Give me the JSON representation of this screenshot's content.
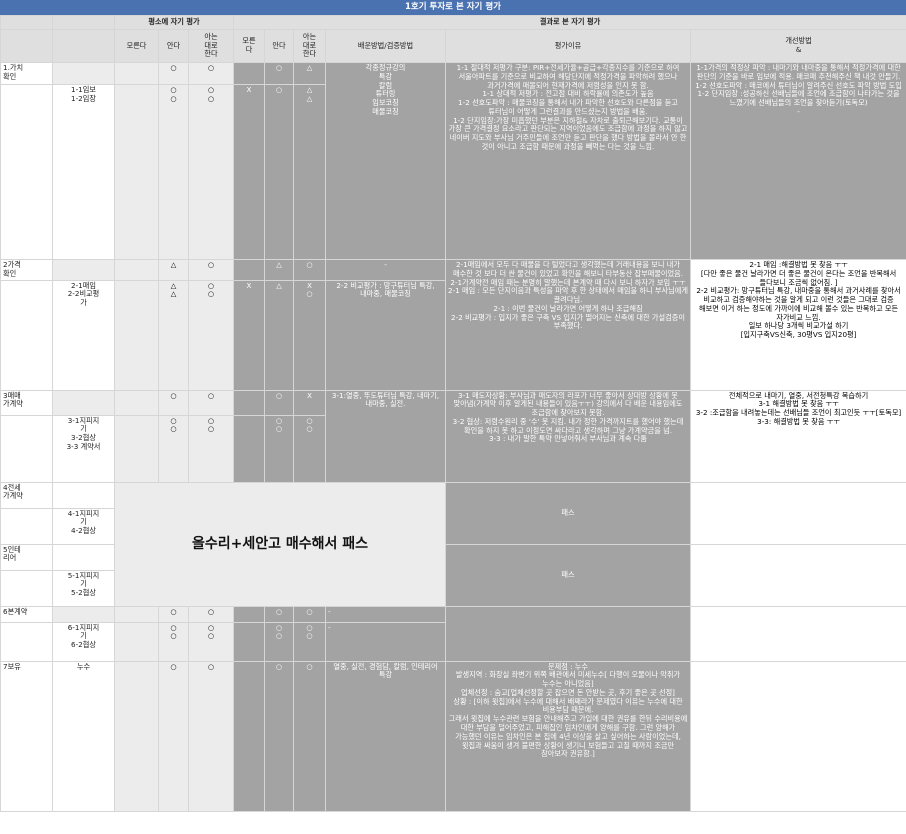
{
  "title": "1호기 투자로 본 자기 평가",
  "header": {
    "usual_group": "평소에 자기 평가",
    "result_group": "결과로 본 자기 평가",
    "col_dont_know": "모른다",
    "col_know": "안다",
    "col_teach": "아는\n대로\n한다",
    "col_dont_know2": "모른\n다",
    "col_know2": "안다",
    "col_teach2": "아는\n대로\n한다",
    "col_learn": "배운방법/검증방법",
    "col_reason": "평가이유",
    "col_improve": "개선방법\n&"
  },
  "rows": {
    "r1": {
      "cat": "1.가치\n확인",
      "know": "○",
      "teach": "○",
      "know2": "○",
      "teach2": "△",
      "learn": "각종정규강의\n특강\n칼럼\n튜터링\n임보코칭\n매물코칭",
      "reason": "1-1 절대적 저평가 구분: PIR+전세가율+공급+각종지수를 기준으로 하여 서울아파트를 기준으로 비교하여 해당단지에 적정가격을 파악하려 했으나 과거가격에 매몰되어 현재가격에 저렴성을 인지 못 함.\n1-1 상대적 저평가 : 전고점 대비 하락률에 의존도가 높음\n1-2 선호도파악 : 매물코칭을 통해서 내가 파악한 선호도와 다른점을 듣고 튜터님이 어떻게 그런결과를 만드셨는지 방법을 배움.\n1-2 단지임장:가장 미흡했던 부분은 지하철& 자차로 출퇴근해보기다. 교통이 가장 큰 가격결정 요소라고 판단되는 지역이었음에도 조급함에 과정을 하지 않고 네이버 지도와 부사님 거주민들에 조언만 듣고 판단을 했다 방법을 몰라서 안 한 것이 아니고 조급함 때문에 과정을 빼먹는 다는 것을 느낌.",
      "improve": "1-1가격의 적정상 파악 : 내마기와 내마중을 통해서 적정가격에 대한 판단의 기준을 바로 임보에 적용. 매코패 추천해주신 책 내것 만들기.\n1-2 선호도파악 : 매코에서 튜터님이 알려주신 선호도 파악 방법 도입\n1-2 단지임장 :성공하신 선배님들에 조언에 조급함이 나타가는 것을 느꼈기에 선배님들의 조언을 찾아듣기(토독모)",
      "improve_dash": "-",
      "sub": "1-1임보\n1-2임장",
      "sub_know": "○\n○",
      "sub_teach": "○\n○",
      "sub_dk2": "X",
      "sub_know2": "○",
      "sub_teach2": "△\n△"
    },
    "r2": {
      "cat": "2가격\n확인",
      "know": "△",
      "teach": "○",
      "know2": "△",
      "teach2": "○",
      "learn": "-",
      "reason": "2-1매임에서 모두 다 매물을 다 털었다고 생각했는데 거래내용을 보니 내가 매수한 것 보다 더 싼 물건이 있었고 확인을 해보니 타부동산 잡부매물이었음.\n2-1가계약전 매임 때는 분명히 말했는데 본계약 때 다시 보니 하자가 보임 ㅜㅜ\n2-1 매임 : 모든 단지이음과 특성을 파악 후 한 상태에서 매임을 하니 부사님에게 끌려다님.\n2-1 : 이번 물건이 날라가면 어떻게 하나 조급해짐\n2-2 비교평가 : 입지가 좋은 구축 VS 입지가 떨어지는 신축에 대한 가설검증이 부족했다.",
      "improve": "2-1 매임 :해결방법 못 찾음 ㅜㅜ\n[다만 좋은 물건 날라가면 더 좋은 물건이 온다는 조언을 반복해서 들다보니 조금씩 없어짐. ]\n2-2 비교평가: 망구튜터님 특강, 내마중을 통해서 과거사례를 찾아서 비교하고 검증해야하는 것을 알게 되고 이런 것들은 그대로 검증 해보면 이거 하는 정도에 가까이에 비교해 볼수 있는 반복하고 모든 자가비교 느낌.\n일보 하나당 3개씩 비교가설 하기\n[입지구축VS신축, 30평VS 입지20평]",
      "sub": "2-1매임\n2-2비교평\n가",
      "sub_know": "△\n△",
      "sub_teach": "○\n○",
      "sub_dk2": "X",
      "sub_know2": "△",
      "sub_teach2": "X\n○",
      "sub_learn": "2-2 비교평가 : 망구튜터님 특강, 내마중, 매물코칭"
    },
    "r3": {
      "cat": "3매매\n가계약",
      "know": "○",
      "teach": "○",
      "know2": "○",
      "teach2": "X",
      "learn": "3-1:열중, 뚜도튜터님 특강, 내마기,내마중, 실전.",
      "reason": "3-1 매도자상황: 부사님과 매도자의 라포가 너무 좋아서 상대방 상황에 못 맞아냄(가계약 이후 알게된 내용들이 있음ㅜㅜ) 강의에서 다 배운 내용임에도 조급함에 찾아보지 못함.\n3-2 협상: 저렴수원리 중 '수' 못 지킴. 내가 정한 가격까지트를 했어야 했는데 확인을 하지 못 하고 이정도면 싸다라고 생각하며 그냥 가계약금을 넘.\n3-3 : 내가 말한 특약 안넣어줘서 부사님과 계속 다툼",
      "improve": "전체적으로 내마기, 열중, 서전청특강 복습하기\n3-1 해결방법 못 찾음 ㅜㅜ\n3-2 :조급함을 내려놓는데는 선배님들 조언이 최고인듯 ㅜㅜ[토독모]\n3-3: 해결방법 못 찾음 ㅜㅜ",
      "sub": "3-1지피지\n기\n3-2협상\n3-3 계약서",
      "sub_know": "○\n○",
      "sub_teach": "○\n○",
      "sub_know2": "○\n○",
      "sub_teach2": "○\n○"
    },
    "r4": {
      "cat": "4전세\n가계약",
      "sub": "4-1지피지\n기\n4-2협상",
      "pass": "패스"
    },
    "r5": {
      "cat": "5인테\n리어",
      "sub": "5-1지피지\n기\n5-2협상",
      "pass": "패스"
    },
    "big_text": "올수리+세안고 매수해서 패스",
    "r6": {
      "cat": "6본계약",
      "know": "○",
      "teach": "○",
      "know2": "○",
      "teach2": "○",
      "learn": "-",
      "sub": "6-1지피지\n기\n6-2협상",
      "sub_know": "○\n○",
      "sub_teach": "○\n○",
      "sub_know2": "○\n○",
      "sub_teach2": "○\n○",
      "sub_learn": "-"
    },
    "r7": {
      "cat": "7보유",
      "sub": "누수",
      "know": "○",
      "teach": "○",
      "know2": "○",
      "teach2": "○",
      "learn": "열중, 실전, 경험담, 칼럼, 인테리어 특강",
      "reason": "문제점 : 누수\n발생지역 : 화장실 좌변기 위쪽 배관에서 미세누수[ 다행이 오물이나 악취가 누수는 아니었음]\n업체선정 : 숨고[업체선정할 곳 잡으면 돈 안받는 곳, 후기 좋은 곳 선정]\n상황 : [이하 윗집]에서 누수에 대해서 배째라가 문제였다 이유는 누수에 대한 비용부담 때문에.\n그래서 윗집에 누수관련 보험을 안내해주고 가입에 대한 권유를 한뒤 수리비용에 대한 부담을 덜어주었고, 피해집인 임차인에게 양해를 구함. 그런 양해가 가능했던 이유는 임차인은 본 집에 4년 이상을 살고 싶어하는 사람이었는데, 윗집과 싸움이 생겨 불편한 상황이 생기니 보험들고 고칠 때까지 조금만 참아보자 권유함.]"
    }
  }
}
